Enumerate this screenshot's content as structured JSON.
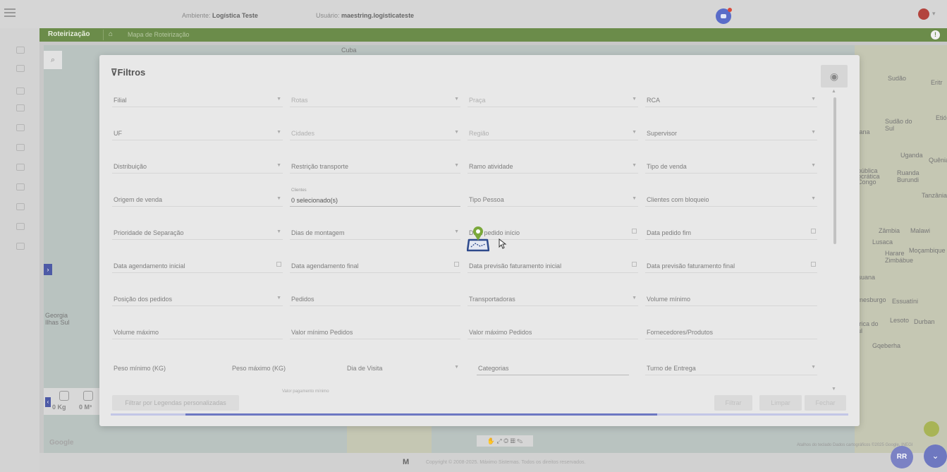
{
  "topbar": {
    "env_label": "Ambiente:",
    "env_value": "Logística Teste",
    "user_label": "Usuário:",
    "user_value": "maestring.logisticateste",
    "menu_icon": "hamburger-icon",
    "bot_icon": "assistant-bot-icon",
    "bell_icon": "notification-bell-icon"
  },
  "greenbar": {
    "title": "Roteirização",
    "breadcrumb": "Mapa de Roteirização",
    "accent": "#6b8c4a"
  },
  "map": {
    "labels": [
      "Cuba",
      "Sudão",
      "Eritr",
      "Sudão do Sul",
      "Etió",
      "cana",
      "Uganda",
      "Quênia",
      "pública ocrática Congo",
      "Ruanda",
      "Burundi",
      "Tanzânia",
      "Zâmbia",
      "Malawi",
      "Lusaca",
      "Harare",
      "Moçambique",
      "Zimbábue",
      "tsuana",
      "anesburgo",
      "Essuatíni",
      "África do Sul",
      "Lesoto",
      "Durban",
      "Gqeberha",
      "Georgia",
      "Ilhas Sul"
    ],
    "stats": {
      "weight": "0 Kg",
      "volume": "0 M³"
    },
    "google": "Google",
    "attribution": "Atalhos do teclado   Dados cartográficos ©2025 Google, INEGI"
  },
  "modal": {
    "title": "Filtros",
    "rows": [
      [
        {
          "label": "Filial",
          "arrow": true,
          "dim": false
        },
        {
          "label": "Rotas",
          "arrow": true,
          "dim": true
        },
        {
          "label": "Praça",
          "arrow": true,
          "dim": true
        },
        {
          "label": "RCA",
          "arrow": true,
          "dim": false
        }
      ],
      [
        {
          "label": "UF",
          "arrow": true,
          "dim": false
        },
        {
          "label": "Cidades",
          "arrow": true,
          "dim": true
        },
        {
          "label": "Região",
          "arrow": true,
          "dim": true
        },
        {
          "label": "Supervisor",
          "arrow": true,
          "dim": false
        }
      ],
      [
        {
          "label": "Distribuição",
          "arrow": true,
          "dim": false
        },
        {
          "label": "Restrição transporte",
          "arrow": true,
          "dim": false
        },
        {
          "label": "Ramo atividade",
          "arrow": true,
          "dim": false
        },
        {
          "label": "Tipo de venda",
          "arrow": true,
          "dim": false
        }
      ],
      [
        {
          "label": "Origem de venda",
          "arrow": true,
          "dim": false
        },
        {
          "label": "Clientes",
          "value": "0 selecionado(s)",
          "arrow": false,
          "dim": false
        },
        {
          "label": "Tipo Pessoa",
          "arrow": true,
          "dim": false
        },
        {
          "label": "Clientes com bloqueio",
          "arrow": true,
          "dim": false
        }
      ],
      [
        {
          "label": "Prioridade de Separação",
          "arrow": true,
          "dim": false
        },
        {
          "label": "Dias de montagem",
          "arrow": true,
          "dim": false
        },
        {
          "label": "Data pedido início",
          "calendar": true,
          "dim": false
        },
        {
          "label": "Data pedido fim",
          "calendar": true,
          "dim": false
        }
      ],
      [
        {
          "label": "Data agendamento inicial",
          "calendar": true,
          "dim": false
        },
        {
          "label": "Data agendamento final",
          "calendar": true,
          "dim": false
        },
        {
          "label": "Data previsão faturamento inicial",
          "calendar": true,
          "dim": false
        },
        {
          "label": "Data previsão faturamento final",
          "calendar": true,
          "dim": false
        }
      ],
      [
        {
          "label": "Posição dos pedidos",
          "arrow": true,
          "dim": false
        },
        {
          "label": "Pedidos",
          "arrow": false,
          "dim": false
        },
        {
          "label": "Transportadoras",
          "arrow": true,
          "dim": false
        },
        {
          "label": "Volume mínimo",
          "arrow": false,
          "dim": false
        }
      ],
      [
        {
          "label": "Volume máximo",
          "arrow": false,
          "dim": false
        },
        {
          "label": "Valor mínimo Pedidos",
          "arrow": false,
          "dim": false
        },
        {
          "label": "Valor máximo Pedidos",
          "arrow": false,
          "dim": false
        },
        {
          "label": "Fornecedores/Produtos",
          "arrow": false,
          "dim": false
        }
      ]
    ],
    "row9": {
      "peso_min": "Peso mínimo (KG)",
      "peso_max": "Peso máximo (KG)",
      "dia_visita": "Dia de Visita",
      "categorias": "Categorias",
      "turno": "Turno de Entrega"
    },
    "cut_label": "Valor pagamento mínimo",
    "btn_legend": "Filtrar por Legendas personalizadas",
    "btn_filtrar": "Filtrar",
    "btn_limpar": "Limpar",
    "btn_fechar": "Fechar",
    "progress": 0.64
  },
  "footer": {
    "logo": "M",
    "text": "Copyright © 2008-2025. Máximo Sistemas. Todos os direitos reservados."
  },
  "fab": {
    "label": "RR"
  },
  "colors": {
    "accent": "#6c77c2",
    "pin": "#7aa83a",
    "loader": "#2e4a8c"
  }
}
